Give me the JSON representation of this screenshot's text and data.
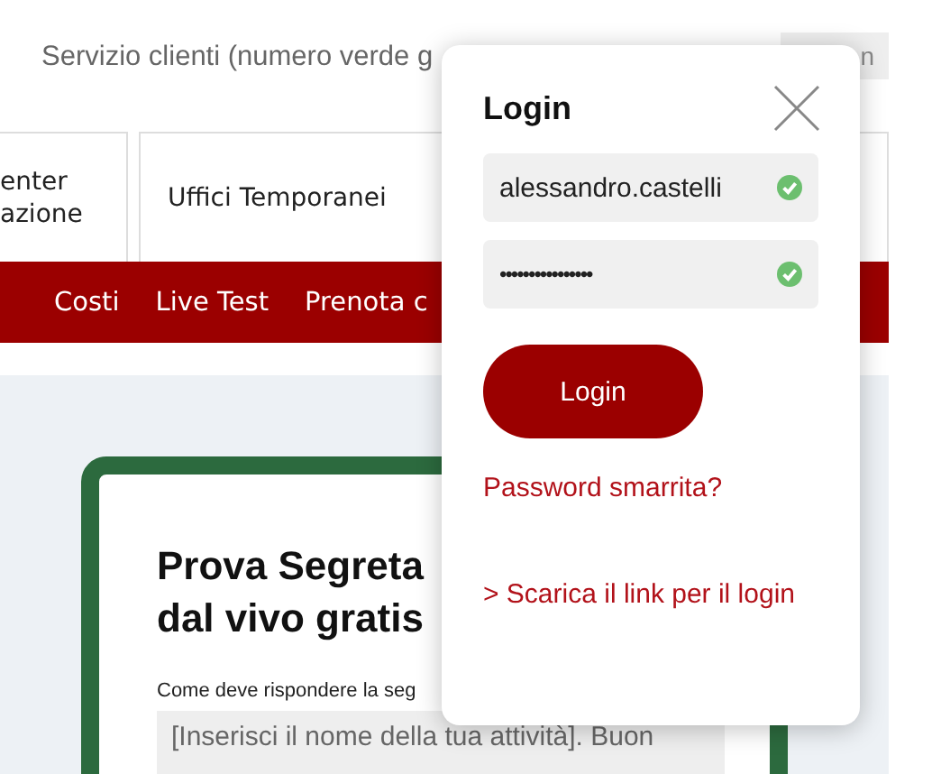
{
  "top_bar": {
    "service_text": "Servizio clienti (numero verde g",
    "button_fragment": "n"
  },
  "category_tabs": [
    {
      "label": "enter\nazione"
    },
    {
      "label": "Uffici Temporanei"
    }
  ],
  "nav": [
    {
      "label": "Costi"
    },
    {
      "label": "Live Test"
    },
    {
      "label": "Prenota c"
    }
  ],
  "trial_card": {
    "title_lines": [
      "Prova Segreta",
      "dal vivo gratis"
    ],
    "question": "Come deve rispondere la seg",
    "answer": "[Inserisci il nome della tua attività]. Buon"
  },
  "login_popup": {
    "title": "Login",
    "fields": [
      {
        "kind": "text",
        "value": "alessandro.castelli",
        "valid": true
      },
      {
        "kind": "password",
        "value": "••••••••••••••••",
        "valid": true
      }
    ],
    "submit": "Login",
    "forgot_link": "Password smarrita?",
    "download_link": "> Scarica il link per il login"
  }
}
